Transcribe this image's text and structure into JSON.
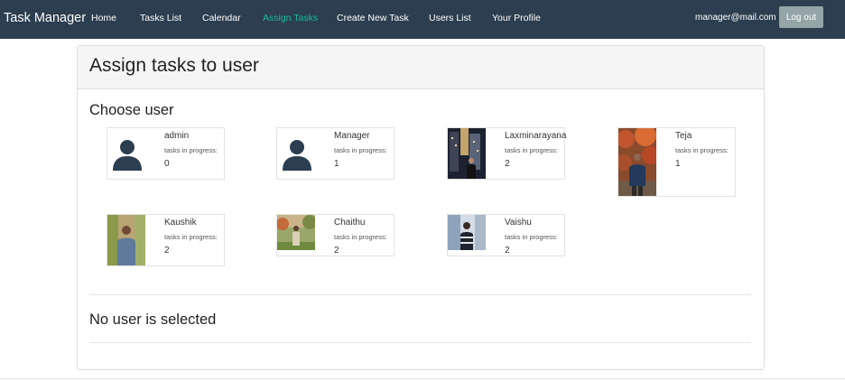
{
  "navbar": {
    "brand": "Task Manager",
    "links": [
      {
        "label": "Home"
      },
      {
        "label": "Tasks List"
      },
      {
        "label": "Calendar"
      },
      {
        "label": "Assign Tasks",
        "active": true
      },
      {
        "label": "Create New Task"
      },
      {
        "label": "Users List"
      },
      {
        "label": "Your Profile"
      }
    ],
    "user_email": "manager@mail.com",
    "logout_label": "Log out",
    "active_color": "#18bc9c",
    "background_color": "#2c3e50"
  },
  "main": {
    "title": "Assign tasks to user",
    "choose_user_heading": "Choose user",
    "tasks_label": "tasks in progress:",
    "users": [
      {
        "name": "admin",
        "tasks_in_progress": "0",
        "avatar": "default-user-icon"
      },
      {
        "name": "Manager",
        "tasks_in_progress": "1",
        "avatar": "default-user-icon"
      },
      {
        "name": "Laxminarayana",
        "tasks_in_progress": "2",
        "avatar": "photo"
      },
      {
        "name": "Teja",
        "tasks_in_progress": "1",
        "avatar": "photo"
      },
      {
        "name": "Kaushik",
        "tasks_in_progress": "2",
        "avatar": "photo"
      },
      {
        "name": "Chaithu",
        "tasks_in_progress": "2",
        "avatar": "photo"
      },
      {
        "name": "Vaishu",
        "tasks_in_progress": "2",
        "avatar": "photo"
      }
    ],
    "selection_status": "No user is selected"
  }
}
